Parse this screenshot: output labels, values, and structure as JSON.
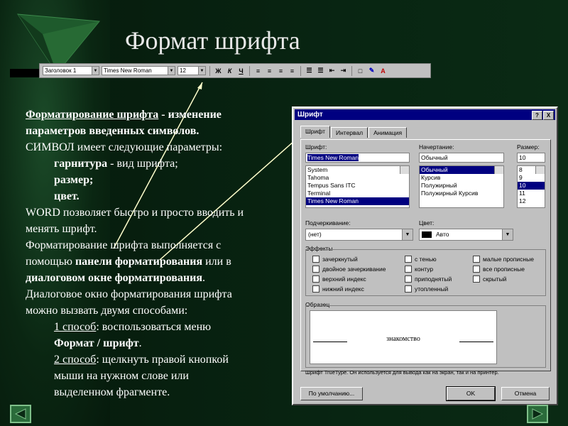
{
  "title": "Формат шрифта",
  "toolbar": {
    "style": "Заголовок 1",
    "font": "Times New Roman",
    "size": "12",
    "bold": "Ж",
    "italic": "К",
    "underline": "Ч"
  },
  "body": {
    "p1_link": "Форматирование шрифта",
    "p1_rest": " - изменение",
    "p2": "параметров введенных символов.",
    "p3": "СИМВОЛ имеет следующие параметры:",
    "p4_bold": "гарнитура",
    "p4_rest": " - вид шрифта;",
    "p5": "размер;",
    "p6": "цвет.",
    "p7": "WORD позволяет быстро и просто вводить и",
    "p8": "менять шрифт.",
    "p9": "Форматирование шрифта выполняется с",
    "p10_a": "помощью ",
    "p10_b": "панели форматирования",
    "p10_c": " или в",
    "p11_b": "диалоговом окне форматирования",
    "p11_c": ".",
    "p12": " Диалоговое окно форматирования шрифта",
    "p13": "можно вызвать двумя способами:",
    "p14_u": "1 способ",
    "p14_rest": ":  воспользоваться меню",
    "p15": "Формат / шрифт",
    "p15_rest": ".",
    "p16_u": "2 способ",
    "p16_rest": ": щелкнуть правой кнопкой",
    "p17": "мыши на нужном слове или",
    "p18": "выделенном фрагменте."
  },
  "dialog": {
    "title": "Шрифт",
    "help": "?",
    "close": "X",
    "tabs": [
      "Шрифт",
      "Интервал",
      "Анимация"
    ],
    "font_label": "Шрифт:",
    "font_value": "Times New Roman",
    "font_list": [
      "System",
      "Tahoma",
      "Tempus Sans ITC",
      "Terminal",
      "Times New Roman"
    ],
    "style_label": "Начертание:",
    "style_value": "Обычный",
    "style_list": [
      "Обычный",
      "Курсив",
      "Полужирный",
      "Полужирный Курсив"
    ],
    "size_label": "Размер:",
    "size_value": "10",
    "size_list": [
      "8",
      "9",
      "10",
      "11",
      "12"
    ],
    "underline_label": "Подчеркивание:",
    "underline_value": "(нет)",
    "color_label": "Цвет:",
    "color_value": "Авто",
    "effects_label": "Эффекты",
    "effects": [
      "зачеркнутый",
      "двойное зачеркивание",
      "верхний индекс",
      "нижний индекс",
      "с тенью",
      "контур",
      "приподнятый",
      "утопленный",
      "малые прописные",
      "все прописные",
      "скрытый"
    ],
    "sample_label": "Образец",
    "sample_text": "знакомство",
    "note": "Шрифт TrueType. Он используется для вывода как на экран, так и на принтер.",
    "default_btn": "По умолчанию...",
    "ok_btn": "OK",
    "cancel_btn": "Отмена"
  },
  "colors": {
    "background": "#082512",
    "dialog": "#c0c0c0",
    "title_bar": "#000080"
  }
}
